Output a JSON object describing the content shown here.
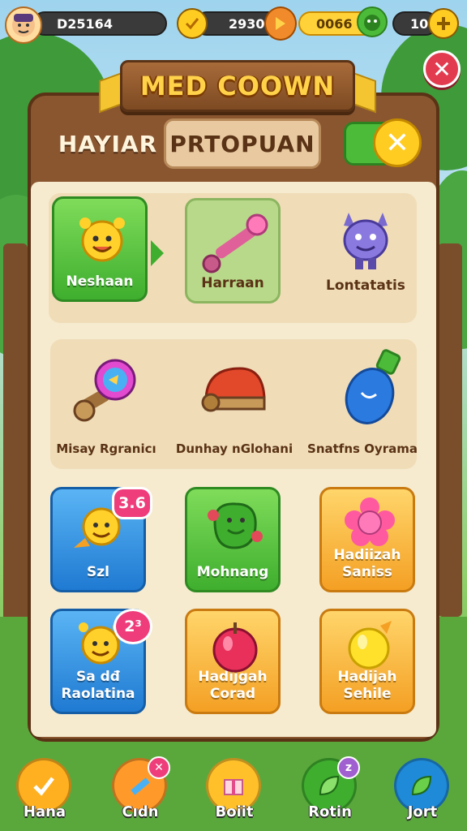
{
  "hud": {
    "player_id": "D25164",
    "coins": "2930",
    "gems": "0066",
    "energy": "10"
  },
  "title": "MED COOWN",
  "tabs": [
    {
      "label": "HAYIAR",
      "active": false
    },
    {
      "label": "PRTOPUAN",
      "active": true
    }
  ],
  "toggle_close": "✕",
  "close_symbol": "✕",
  "featured_items": [
    {
      "label": "Neshaan",
      "icon": "sun-mascot-icon",
      "style": "green"
    },
    {
      "label": "Harraan",
      "icon": "pink-wand-icon",
      "style": "light-green"
    },
    {
      "label": "Lontatatis",
      "icon": "purple-monster-icon",
      "style": "plain"
    }
  ],
  "tools": [
    {
      "label": "Misay Rgranicı",
      "icon": "magic-scepter-icon"
    },
    {
      "label": "Dunhay nGlohani",
      "icon": "red-helmet-icon"
    },
    {
      "label": "Snatfns Oyrama",
      "icon": "blue-potion-icon"
    }
  ],
  "rewards": [
    {
      "label": "Szl",
      "icon": "sun-rocket-icon",
      "style": "blue",
      "badge": "3.6"
    },
    {
      "label": "Mohnang",
      "icon": "green-blob-icon",
      "style": "green"
    },
    {
      "label": "Hadiizah Saniss",
      "icon": "pink-flower-icon",
      "style": "orange"
    },
    {
      "label": "Sa dđ Raolatina",
      "icon": "sun-mascot-icon",
      "style": "blue",
      "badge": "2³"
    },
    {
      "label": "Hadijgah Corad",
      "icon": "red-apple-icon",
      "style": "orange"
    },
    {
      "label": "Hadijah Sehile",
      "icon": "yellow-fruit-icon",
      "style": "orange"
    }
  ],
  "nav": [
    {
      "label": "Hana",
      "icon": "check-icon",
      "color": "#ffb020"
    },
    {
      "label": "Cıdn",
      "icon": "pencil-icon",
      "color": "#ff9a2a",
      "badge": "✕"
    },
    {
      "label": "Boiit",
      "icon": "gift-box-icon",
      "color": "#ffc02a"
    },
    {
      "label": "Rotin",
      "icon": "leaf-icon",
      "color": "#3fae2e",
      "badge": "z"
    },
    {
      "label": "Jort",
      "icon": "leaf-icon",
      "color": "#1f8ad8"
    }
  ],
  "colors": {
    "panel_wood": "#8a5630",
    "panel_inner": "#f6ebcf",
    "accent_gold": "#ffd24a",
    "close_red": "#e23b4f"
  }
}
